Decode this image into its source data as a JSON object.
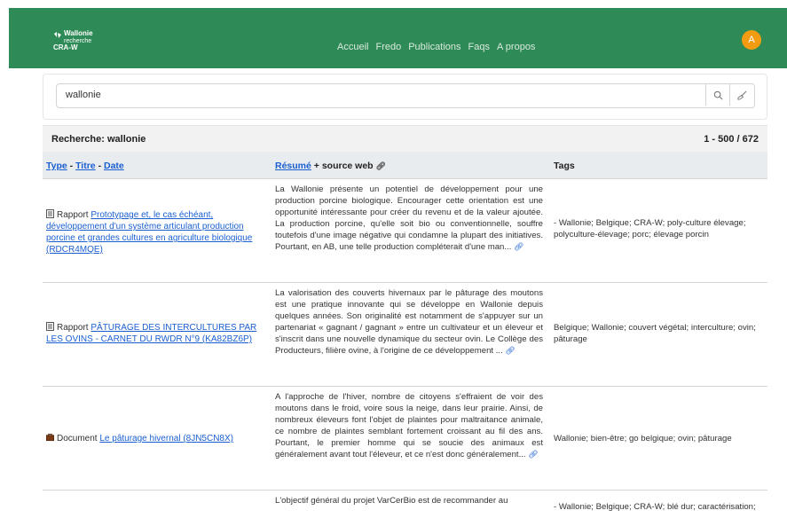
{
  "header": {
    "logo_line1": "Wallonie",
    "logo_line2": "recherche",
    "logo_line3": "CRA-W",
    "nav": [
      "Accueil",
      "Fredo",
      "Publications",
      "Faqs",
      "A propos"
    ],
    "avatar_initial": "A"
  },
  "search": {
    "value": "wallonie",
    "search_icon": "search-icon",
    "clear_icon": "broom-icon"
  },
  "results": {
    "title": "Recherche: wallonie",
    "count": "1 - 500 / 672"
  },
  "table": {
    "col1_type": "Type",
    "col1_title": "Titre",
    "col1_date": "Date",
    "sep": "-",
    "col2_resume": "Résumé",
    "col2_suffix": "+ source web",
    "col3": "Tags",
    "rows": [
      {
        "icon": "report-icon",
        "type": "Rapport",
        "title": "Prototypage et, le cas échéant, développement d'un système articulant production porcine et grandes cultures en agriculture biologique (RDCR4MQE)",
        "summary": "La Wallonie présente un potentiel de développement pour une production porcine biologique. Encourager cette orientation est une opportunité intéressante pour créer du revenu et de la valeur ajoutée. La production porcine, qu'elle soit bio ou conventionnelle, souffre toutefois d'une image négative qui condamne la plupart des initiatives. Pourtant, en AB, une telle production compléterait d'une man...",
        "tags": "- Wallonie; Belgique; CRA-W; poly-culture élevage; polyculture-élevage; porc; élevage porcin"
      },
      {
        "icon": "report-icon",
        "type": "Rapport",
        "title": "PÂTURAGE DES INTERCULTURES PAR LES OVINS - CARNET DU RWDR N°9 (KA82BZ6P)",
        "summary": "La valorisation des couverts hivernaux par le pâturage des moutons est une pratique innovante qui se développe en Wallonie depuis quelques années. Son originalité est notamment de s'appuyer sur un partenariat « gagnant / gagnant » entre un cultivateur et un éleveur et s'inscrit dans une nouvelle dynamique du secteur ovin. Le Collège des Producteurs, filière ovine, à l'origine de ce développement ...",
        "tags": "Belgique; Wallonie; couvert végétal; interculture; ovin; pâturage"
      },
      {
        "icon": "briefcase-icon",
        "type": "Document",
        "title": "Le pâturage hivernal (8JN5CN8X)",
        "summary": "A l'approche de l'hiver, nombre de citoyens s'effraient de voir des moutons dans le froid, voire sous la neige, dans leur prairie. Ainsi, de nombreux éleveurs font l'objet de plaintes pour maltraitance animale, ce nombre de plaintes semblant fortement croissant au fil des ans. Pourtant, le premier homme qui se soucie des animaux est généralement avant tout l'éleveur, et ce n'est donc généralement...",
        "tags": "Wallonie; bien-être; go belgique; ovin; pâturage"
      },
      {
        "icon": "report-icon",
        "type": "",
        "title": "",
        "summary": "L'objectif général du projet VarCerBio est de recommander au",
        "tags": "- Wallonie; Belgique; CRA-W; blé dur; caractérisation;"
      }
    ]
  },
  "colors": {
    "header_bg": "#2e8b57",
    "link": "#1a5fd1",
    "avatar": "#f39c12"
  }
}
